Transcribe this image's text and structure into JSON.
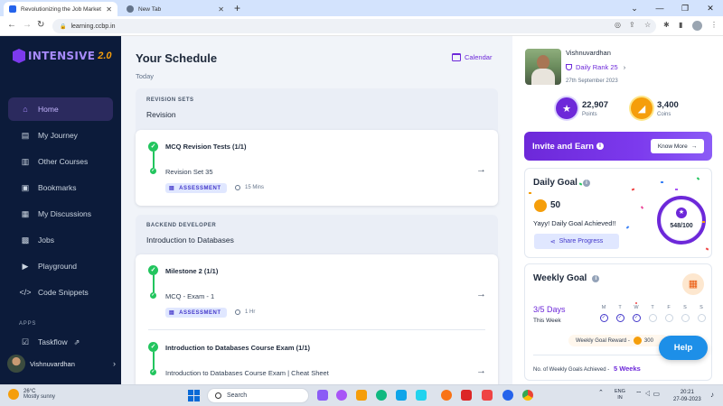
{
  "browser": {
    "tabs": [
      {
        "title": "Revolutionizing the Job Market",
        "favicon_color": "#2563eb"
      },
      {
        "title": "New Tab",
        "favicon_color": "#64748b"
      }
    ],
    "url": "learning.ccbp.in"
  },
  "sidebar": {
    "logo_text": "INTENSIVE",
    "logo_version": "2.0",
    "items": [
      {
        "label": "Home",
        "icon": "home-icon",
        "active": true
      },
      {
        "label": "My Journey",
        "icon": "journey-icon"
      },
      {
        "label": "Other Courses",
        "icon": "book-icon"
      },
      {
        "label": "Bookmarks",
        "icon": "bookmark-icon"
      },
      {
        "label": "My Discussions",
        "icon": "discussion-icon"
      },
      {
        "label": "Jobs",
        "icon": "briefcase-icon"
      },
      {
        "label": "Playground",
        "icon": "terminal-icon"
      },
      {
        "label": "Code Snippets",
        "icon": "code-icon"
      }
    ],
    "apps_label": "APPS",
    "apps": [
      {
        "label": "Taskflow",
        "icon": "checkbox-icon"
      }
    ],
    "user_name": "Vishnuvardhan"
  },
  "schedule": {
    "title": "Your Schedule",
    "date_label": "Today",
    "calendar_label": "Calendar",
    "sections": [
      {
        "caption": "REVISION SETS",
        "subtitle": "Revision",
        "milestone": "MCQ Revision Tests (1/1)",
        "item": "Revision Set 35",
        "tag": "ASSESSMENT",
        "duration": "15 Mins"
      },
      {
        "caption": "BACKEND DEVELOPER",
        "subtitle": "Introduction to Databases",
        "milestone": "Milestone 2 (1/1)",
        "item": "MCQ - Exam - 1",
        "tag": "ASSESSMENT",
        "duration": "1 Hr",
        "milestone2": "Introduction to Databases Course Exam (1/1)",
        "item2": "Introduction to Databases Course Exam | Cheat Sheet"
      }
    ]
  },
  "profile": {
    "name": "Vishnuvardhan",
    "rank_label": "Daily Rank 25",
    "date": "27th September 2023",
    "points_value": "22,907",
    "points_label": "Points",
    "coins_value": "3,400",
    "coins_label": "Coins"
  },
  "invite": {
    "title": "Invite and Earn",
    "button": "Know More"
  },
  "daily_goal": {
    "title": "Daily Goal",
    "streak": "50",
    "message": "Yayy! Daily Goal Achieved!!",
    "share_label": "Share Progress",
    "progress_text": "548/100"
  },
  "weekly_goal": {
    "title": "Weekly Goal",
    "days_text": "3/5 Days",
    "this_week": "This Week",
    "days": [
      {
        "label": "M",
        "done": true
      },
      {
        "label": "T",
        "done": true
      },
      {
        "label": "W",
        "done": true,
        "marker": true
      },
      {
        "label": "T",
        "done": false
      },
      {
        "label": "F",
        "done": false
      },
      {
        "label": "S",
        "done": false
      },
      {
        "label": "S",
        "done": false
      }
    ],
    "reward_label": "Weekly Goal Reward -",
    "reward_value": "300",
    "achieved_label": "No. of Weekly Goals Achieved -",
    "achieved_value": "5 Weeks"
  },
  "help_label": "Help",
  "taskbar": {
    "temp": "26°C",
    "weather": "Mostly sunny",
    "search": "Search",
    "lang_top": "ENG",
    "lang_bottom": "IN",
    "time": "20:21",
    "date": "27-09-2023"
  },
  "colors": {
    "accent": "#6d28d9",
    "sidebar_bg": "#0c1b3a",
    "success": "#22c55e",
    "help": "#1d8fe8"
  }
}
